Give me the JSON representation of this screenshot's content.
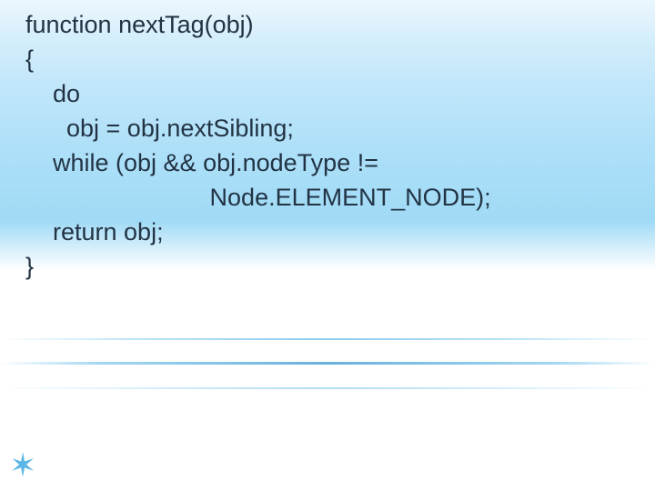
{
  "code": {
    "lines": [
      "function nextTag(obj)",
      "{",
      "    do",
      "      obj = obj.nextSibling;",
      "    while (obj && obj.nodeType !=",
      "                           Node.ELEMENT_NODE);",
      "    return obj;",
      "}"
    ]
  },
  "decor": {
    "star_glyph": "✶"
  }
}
